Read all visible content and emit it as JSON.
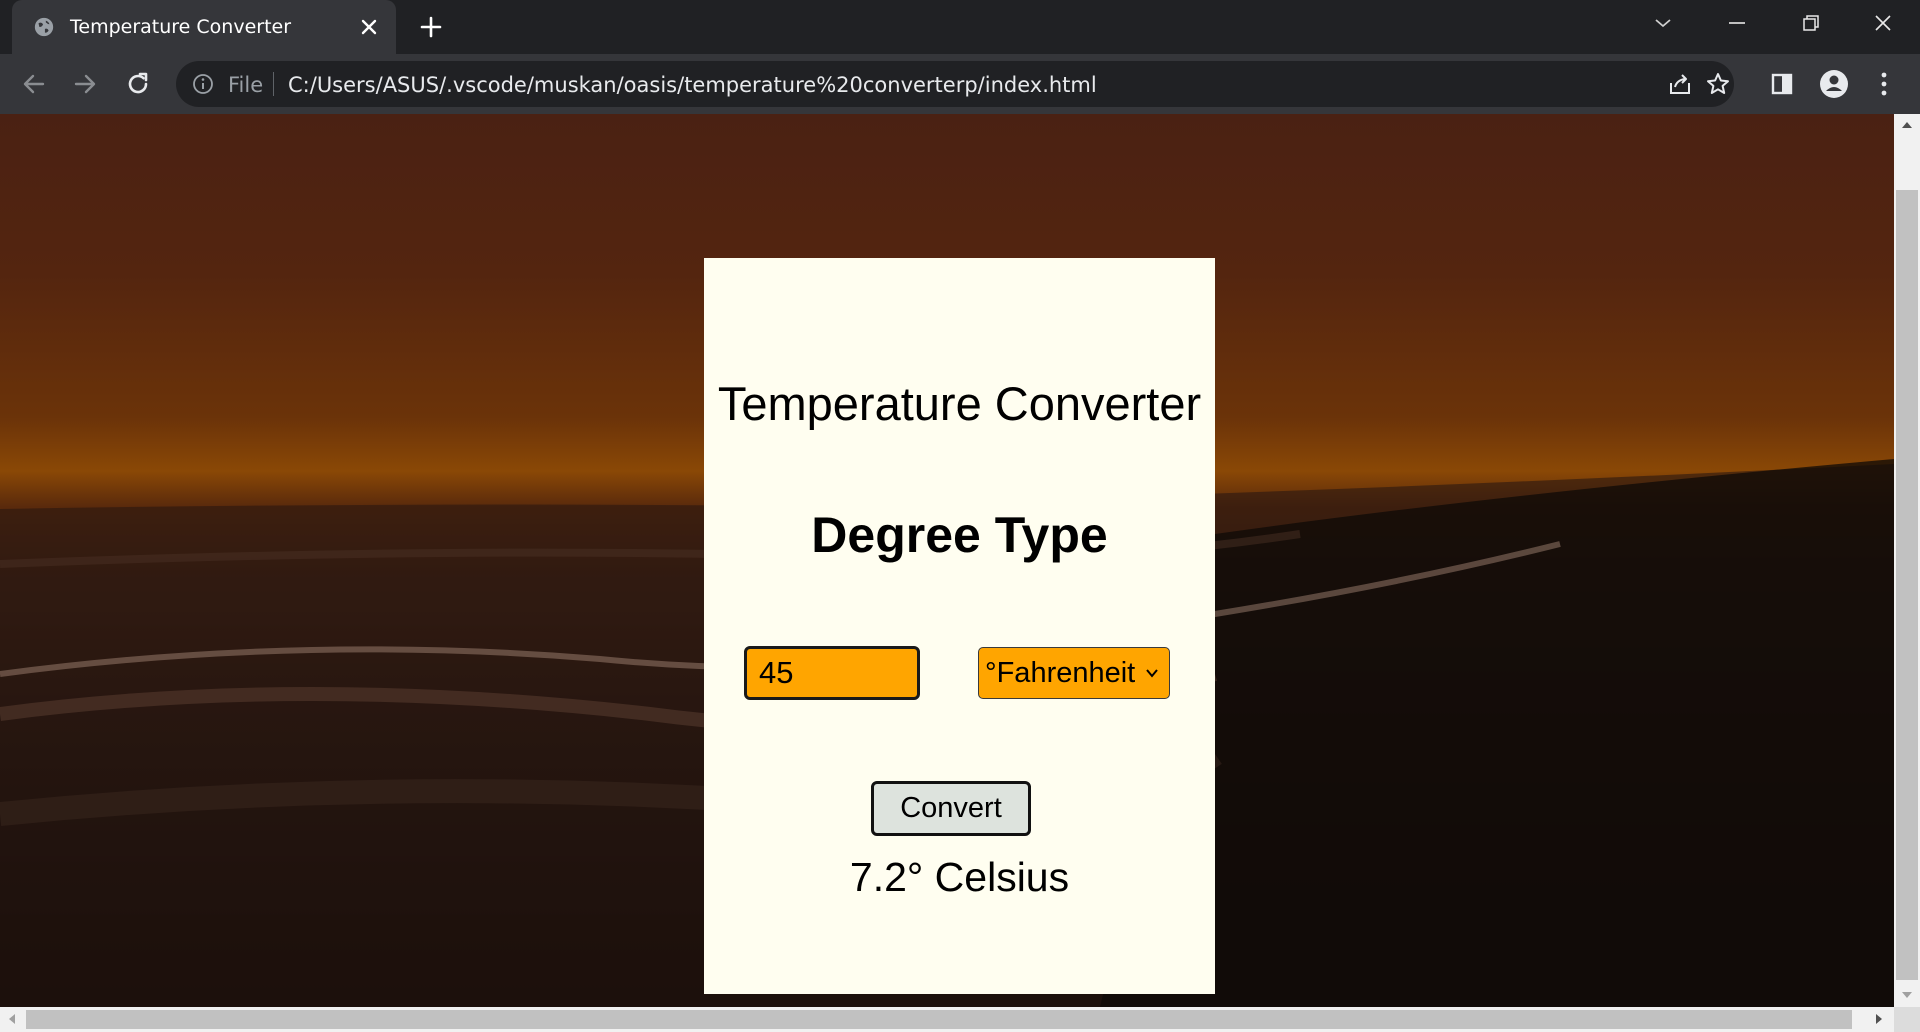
{
  "browser": {
    "tab": {
      "title": "Temperature Converter",
      "favicon": "globe-icon"
    },
    "address": {
      "scheme": "File",
      "url": "C:/Users/ASUS/.vscode/muskan/oasis/temperature%20converterp/index.html"
    },
    "icons": [
      "back-arrow-icon",
      "forward-arrow-icon",
      "reload-icon",
      "info-icon",
      "share-icon",
      "star-icon",
      "side-panel-icon",
      "profile-icon",
      "more-vert-icon"
    ]
  },
  "page": {
    "title": "Temperature Converter",
    "subtitle": "Degree Type",
    "input_value": "45",
    "unit_selected": "°Fahrenheit",
    "convert_label": "Convert",
    "result": "7.2° Celsius"
  },
  "colors": {
    "card_bg": "#fffef0",
    "accent_orange": "#ffa500",
    "button_bg": "#dde3dd"
  }
}
